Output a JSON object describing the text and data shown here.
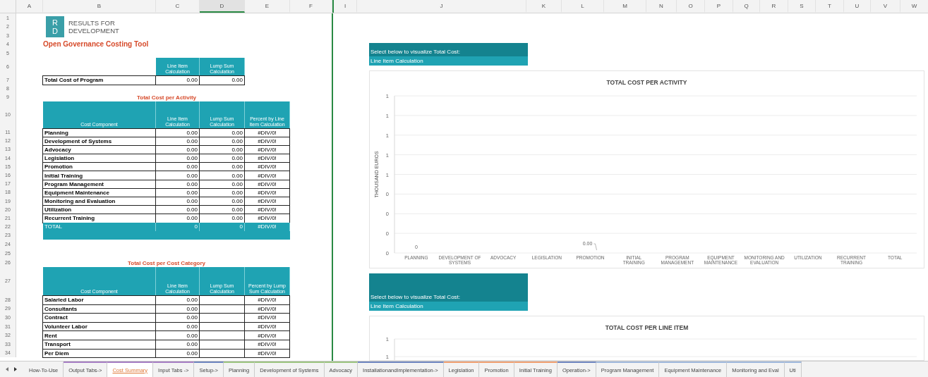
{
  "column_headers": [
    {
      "label": "A",
      "selected": false
    },
    {
      "label": "B",
      "selected": false
    },
    {
      "label": "C",
      "selected": false
    },
    {
      "label": "D",
      "selected": true
    },
    {
      "label": "E",
      "selected": false
    },
    {
      "label": "F",
      "selected": false
    },
    {
      "label": "I",
      "selected": false
    },
    {
      "label": "J",
      "selected": false
    },
    {
      "label": "K",
      "selected": false
    },
    {
      "label": "L",
      "selected": false
    },
    {
      "label": "M",
      "selected": false
    },
    {
      "label": "N",
      "selected": false
    },
    {
      "label": "O",
      "selected": false
    },
    {
      "label": "P",
      "selected": false
    },
    {
      "label": "Q",
      "selected": false
    },
    {
      "label": "R",
      "selected": false
    },
    {
      "label": "S",
      "selected": false
    },
    {
      "label": "T",
      "selected": false
    },
    {
      "label": "U",
      "selected": false
    },
    {
      "label": "V",
      "selected": false
    },
    {
      "label": "W",
      "selected": false
    }
  ],
  "row_numbers": [
    "1",
    "2",
    "3",
    "4",
    "5",
    "6",
    "7",
    "8",
    "9",
    "10",
    "11",
    "12",
    "13",
    "14",
    "15",
    "16",
    "17",
    "18",
    "19",
    "20",
    "21",
    "22",
    "23",
    "24",
    "25",
    "26",
    "27",
    "28",
    "29",
    "30",
    "31",
    "32",
    "33",
    "34"
  ],
  "logo": {
    "mark_top": "R",
    "mark_bottom": "D",
    "line_1": "RESULTS FOR",
    "line_2": "DEVELOPMENT"
  },
  "title": "Open Governance Costing Tool",
  "summary": {
    "headers": [
      "Line Item Calculation",
      "Lump Sum Calculation"
    ],
    "label": "Total Cost of Program",
    "values": [
      "0.00",
      "0.00"
    ]
  },
  "activity_table": {
    "title": "Total Cost per Activity",
    "headers": [
      "Cost Component",
      "Line Item Calculation",
      "Lump Sum Calculation",
      "Percent by Line Item Calculation"
    ],
    "rows": [
      [
        "Planning",
        "0.00",
        "0.00",
        "#DIV/0!"
      ],
      [
        "Development of Systems",
        "0.00",
        "0.00",
        "#DIV/0!"
      ],
      [
        "Advocacy",
        "0.00",
        "0.00",
        "#DIV/0!"
      ],
      [
        "Legislation",
        "0.00",
        "0.00",
        "#DIV/0!"
      ],
      [
        "Promotion",
        "0.00",
        "0.00",
        "#DIV/0!"
      ],
      [
        "Initial Training",
        "0.00",
        "0.00",
        "#DIV/0!"
      ],
      [
        "Program Management",
        "0.00",
        "0.00",
        "#DIV/0!"
      ],
      [
        "Equipment Maintenance",
        "0.00",
        "0.00",
        "#DIV/0!"
      ],
      [
        "Monitoring and Evaluation",
        "0.00",
        "0.00",
        "#DIV/0!"
      ],
      [
        "Utilization",
        "0.00",
        "0.00",
        "#DIV/0!"
      ],
      [
        "Recurrent Training",
        "0.00",
        "0.00",
        "#DIV/0!"
      ]
    ],
    "total": [
      "TOTAL",
      "0",
      "0",
      "#DIV/0!"
    ]
  },
  "category_table": {
    "title": "Total Cost per Cost Category",
    "headers": [
      "Cost Component",
      "Line Item Calculation",
      "Lump Sum Calculation",
      "Percent by Lump Sum Calculation"
    ],
    "rows": [
      [
        "Salaried Labor",
        "0.00",
        "#DIV/0!"
      ],
      [
        "Consultants",
        "0.00",
        "#DIV/0!"
      ],
      [
        "Contract",
        "0.00",
        "#DIV/0!"
      ],
      [
        "Volunteer Labor",
        "0.00",
        "#DIV/0!"
      ],
      [
        "Rent",
        "0.00",
        "#DIV/0!"
      ],
      [
        "Transport",
        "0.00",
        "#DIV/0!"
      ],
      [
        "Per Diem",
        "0.00",
        "#DIV/0!"
      ]
    ]
  },
  "selectors": [
    {
      "prompt": "Select below to visualize Total Cost:",
      "value": "Line Item Calculation"
    },
    {
      "prompt": "Select below to visualize Total Cost:",
      "value": "Line Item Calculation"
    }
  ],
  "charts": [
    {
      "chart_data": {
        "type": "bar",
        "title": "TOTAL COST PER ACTIVITY",
        "ylabel": "THOUSAND EUROS",
        "categories": [
          "PLANNING",
          "DEVELOPMENT OF SYSTEMS",
          "ADVOCACY",
          "LEGISLATION",
          "PROMOTION",
          "INITIAL TRAINING",
          "PROGRAM MANAGEMENT",
          "EQUIPMENT MAINTENANCE",
          "MONITORING AND EVALUATION",
          "UTILIZATION",
          "RECURRENT TRAINING",
          "TOTAL"
        ],
        "values": [
          0,
          0,
          0,
          0,
          0,
          0,
          0,
          0,
          0,
          0,
          0,
          0
        ],
        "ylim": [
          0,
          1
        ],
        "yticks": [
          {
            "value": 0,
            "label": "0"
          },
          {
            "value": 0.125,
            "label": "0"
          },
          {
            "value": 0.25,
            "label": "0"
          },
          {
            "value": 0.375,
            "label": "0"
          },
          {
            "value": 0.5,
            "label": "1"
          },
          {
            "value": 0.625,
            "label": "1"
          },
          {
            "value": 0.75,
            "label": "1"
          },
          {
            "value": 0.875,
            "label": "1"
          },
          {
            "value": 1,
            "label": "1"
          }
        ],
        "grid": true,
        "value_labels": [
          "0",
          null,
          null,
          null,
          "0.00",
          null,
          null,
          null,
          null,
          null,
          null,
          null
        ]
      }
    },
    {
      "chart_data": {
        "type": "other",
        "title": "TOTAL COST PER LINE ITEM"
      },
      "axis_labels": [
        "1",
        "1"
      ]
    }
  ],
  "sheet_tabs": [
    {
      "label": "How-To-Use",
      "selected": false
    },
    {
      "label": "Output Tabs->",
      "selected": false,
      "color": "#a77fc4"
    },
    {
      "label": "Cost Summary",
      "selected": true,
      "color": "#a77fc4"
    },
    {
      "label": "Input Tabs ->",
      "selected": false,
      "color": "#a77fc4"
    },
    {
      "label": "Setup->",
      "selected": false,
      "color": "#6f86c0"
    },
    {
      "label": "Planning",
      "selected": false,
      "color": "#9cc480"
    },
    {
      "label": "Development of Systems",
      "selected": false,
      "color": "#9cc480"
    },
    {
      "label": "Advocacy",
      "selected": false,
      "color": "#9cc480"
    },
    {
      "label": "InstallationandImplementation->",
      "selected": false,
      "color": "#6f86c0"
    },
    {
      "label": "Legislation",
      "selected": false,
      "color": "#f0a070"
    },
    {
      "label": "Promotion",
      "selected": false,
      "color": "#f0a070"
    },
    {
      "label": "Initial Training",
      "selected": false,
      "color": "#f0a070"
    },
    {
      "label": "Operation->",
      "selected": false,
      "color": "#6f86c0"
    },
    {
      "label": "Program Management",
      "selected": false,
      "color": "#9fb8dc"
    },
    {
      "label": "Equipment Maintenance",
      "selected": false,
      "color": "#9fb8dc"
    },
    {
      "label": "Monitoring and Eval",
      "selected": false,
      "color": "#9fb8dc"
    },
    {
      "label": "Uti",
      "selected": false,
      "color": "#9fb8dc"
    }
  ]
}
